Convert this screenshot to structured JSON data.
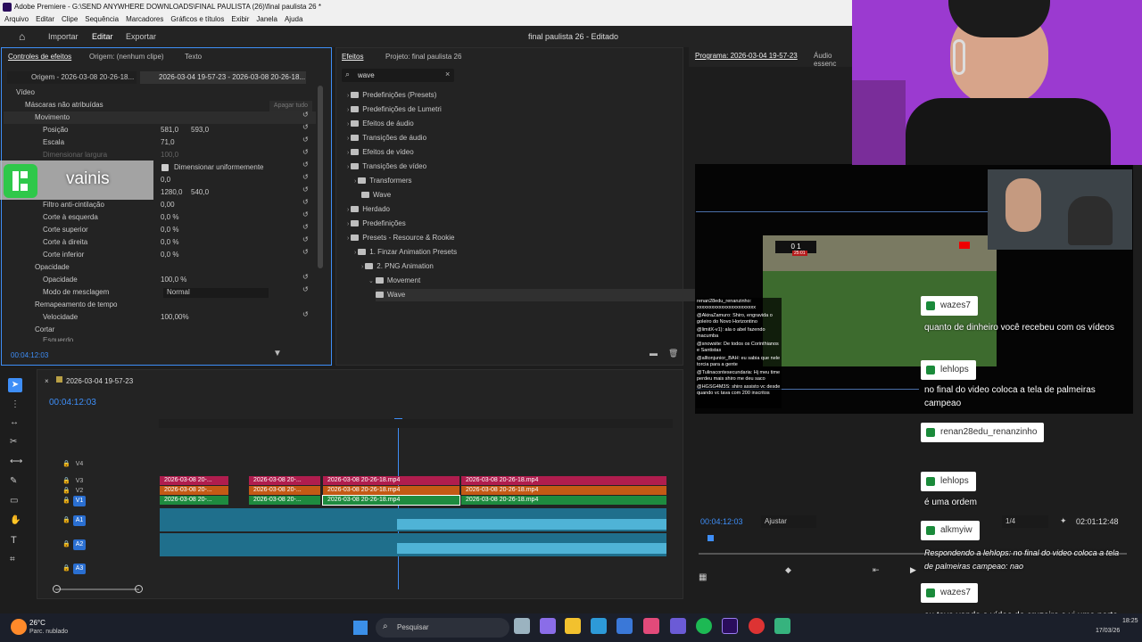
{
  "window": {
    "title": "Adobe Premiere - G:\\SEND ANYWHERE DOWNLOADS\\FINAL PAULISTA (26)\\final paulista 26 *"
  },
  "menu": [
    "Arquivo",
    "Editar",
    "Clipe",
    "Sequência",
    "Marcadores",
    "Gráficos e títulos",
    "Exibir",
    "Janela",
    "Ajuda"
  ],
  "workspace": {
    "tabs": [
      "Importar",
      "Editar",
      "Exportar"
    ],
    "project_title": "final paulista 26 - Editado"
  },
  "effect_controls": {
    "tabs": [
      "Controles de efeitos",
      "Origem: (nenhum clipe)",
      "Texto"
    ],
    "source": "Origem - 2026-03-08 20-26-18...",
    "sequence": "2026-03-04 19-57-23 - 2026-03-08 20-26-18...",
    "video_label": "Vídeo",
    "masks": "Máscaras não atribuídas",
    "clear_all": "Apagar tudo",
    "motion": "Movimento",
    "position": "Posição",
    "pos_x": "581,0",
    "pos_y": "593,0",
    "scale": "Escala",
    "scale_val": "71,0",
    "scale_width": "Dimensionar largura",
    "scale_width_val": "100,0",
    "uniform": "Dimensionar uniformemente",
    "rotation_val": "0,0",
    "anchor_x": "1280,0",
    "anchor_y": "540,0",
    "antiflicker": "Filtro anti-cintilação",
    "antiflicker_val": "0,00",
    "crop_left": "Corte à esquerda",
    "crop_top": "Corte superior",
    "crop_right": "Corte à direita",
    "crop_bottom": "Corte inferior",
    "crop_val": "0,0 %",
    "opacity": "Opacidade",
    "opacity_val": "100,0 %",
    "blend": "Modo de mesclagem",
    "blend_val": "Normal",
    "time_remap": "Remapeamento de tempo",
    "speed": "Velocidade",
    "speed_val": "100,00%",
    "crop": "Cortar",
    "crop_partial": "Esquerdo",
    "timecode": "00:04:12:03"
  },
  "overlay_label": "vainis",
  "effects": {
    "tabs": [
      "Efeitos",
      "Projeto: final paulista 26"
    ],
    "search": "wave",
    "tree": [
      {
        "label": "Predefinições (Presets)",
        "depth": 0
      },
      {
        "label": "Predefinições de Lumetri",
        "depth": 0
      },
      {
        "label": "Efeitos de áudio",
        "depth": 0
      },
      {
        "label": "Transições de áudio",
        "depth": 0
      },
      {
        "label": "Efeitos de vídeo",
        "depth": 0
      },
      {
        "label": "Transições de vídeo",
        "depth": 0
      },
      {
        "label": "Transformers",
        "depth": 1
      },
      {
        "label": "Wave",
        "depth": 2
      },
      {
        "label": "Herdado",
        "depth": 0
      },
      {
        "label": "Predefinições",
        "depth": 0
      },
      {
        "label": "Presets - Resource & Rookie",
        "depth": 0
      },
      {
        "label": "1. Finzar Animation Presets",
        "depth": 1
      },
      {
        "label": "2. PNG Animation",
        "depth": 2
      },
      {
        "label": "Movement",
        "depth": 3
      },
      {
        "label": "Wave",
        "depth": 4
      }
    ]
  },
  "program": {
    "title": "Programa: 2026-03-04 19-57-23",
    "audio_tab": "Áudio essenc",
    "timecode": "00:04:12:03",
    "fit": "Ajustar",
    "quality": "1/4",
    "duration": "02:01:12:48"
  },
  "timeline": {
    "sequence": "2026-03-04 19-57-23",
    "timecode": "00:04:12:03",
    "tracks": [
      "V4",
      "V3",
      "V2",
      "V1",
      "A1",
      "A2",
      "A3"
    ],
    "clip_short": "2026-03-08 20-...",
    "clip_long": "2026-03-08 20-26-18.mp4"
  },
  "stream_chat": {
    "small_lines": [
      "renan28edu_renanzinho: xxxxxxxxxxxxxxxxxxxxxxxx",
      "@AkiraZamuro: Shiro, engravida o goleiro do Novo Horizontino",
      "@limitX-v1): ala o abel fazendo macumba",
      "@snowsite: De todos os Corinthianos e Santistas",
      "@alltonjunior_BAH: eu sabia que nele torcia para a gente",
      "@Tulinacontesecundaria: Hj meu time perdeu mais shiro me deu saco",
      "@HGSG4M3S: shiro assisto vc desde quando vc tava com 200 inscritos"
    ],
    "messages": [
      {
        "name": "wazes7",
        "text": "quanto de dinheiro você recebeu com os vídeos"
      },
      {
        "name": "lehlops",
        "text": "no final do video coloca a tela de palmeiras campeao"
      },
      {
        "name": "renan28edu_renanzinho",
        "text": ""
      },
      {
        "name": "lehlops",
        "text": "é uma ordem"
      },
      {
        "name": "alkmyiw",
        "text": "Respondendo a lehlops: no final do video coloca a tela de palmeiras campeao:  nao"
      },
      {
        "name": "wazes7",
        "text": "eu tava vendo o vídeo do cruzeiro e vi uma parte que quase você beijo o shiro"
      }
    ]
  },
  "scoreboard": "0 1",
  "scoreboard_time": "25:01",
  "taskbar": {
    "temp": "26°C",
    "weather": "Parc. nublado",
    "search": "Pesquisar",
    "time": "18:25",
    "date": "17/03/26"
  }
}
